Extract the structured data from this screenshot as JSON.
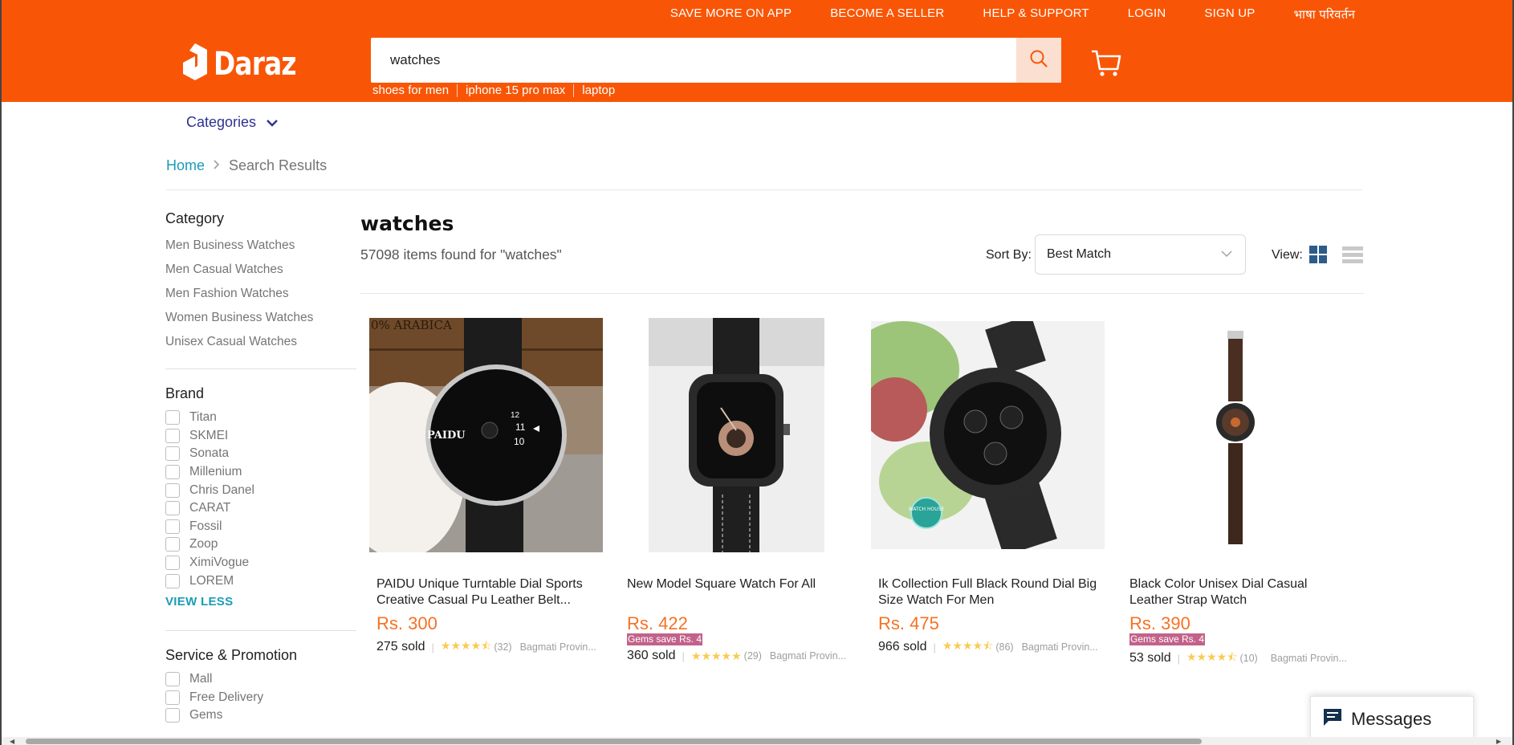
{
  "header": {
    "top_links": [
      "SAVE MORE ON APP",
      "BECOME A SELLER",
      "HELP & SUPPORT",
      "LOGIN",
      "SIGN UP",
      "भाषा परिवर्तन"
    ],
    "logo_text": "Daraz",
    "search": {
      "value": "watches"
    },
    "suggestions": [
      "shoes for men",
      "iphone 15 pro max",
      "laptop"
    ],
    "brand_color": "#f85606"
  },
  "nav": {
    "categories_label": "Categories"
  },
  "breadcrumb": {
    "home": "Home",
    "current": "Search Results"
  },
  "sidebar": {
    "category_title": "Category",
    "categories": [
      "Men Business Watches",
      "Men Casual Watches",
      "Men Fashion Watches",
      "Women Business Watches",
      "Unisex Casual Watches"
    ],
    "brand_title": "Brand",
    "brands": [
      "Titan",
      "SKMEI",
      "Sonata",
      "Millenium",
      "Chris Danel",
      "CARAT",
      "Fossil",
      "Zoop",
      "XimiVogue",
      "LOREM"
    ],
    "view_less": "VIEW LESS",
    "service_title": "Service & Promotion",
    "services": [
      "Mall",
      "Free Delivery",
      "Gems"
    ]
  },
  "results": {
    "title": "watches",
    "count_text": "57098 items found for \"watches\"",
    "sort_label": "Sort By:",
    "sort_value": "Best Match",
    "view_label": "View:"
  },
  "products": [
    {
      "name": "PAIDU Unique Turntable Dial Sports Creative Casual Pu Leather Belt...",
      "price": "Rs. 300",
      "gems": "",
      "sold": "275 sold",
      "rating": 4.5,
      "reviews": "(32)",
      "location": "Bagmati Provin..."
    },
    {
      "name": "New Model Square Watch For All",
      "price": "Rs. 422",
      "gems": "Gems save Rs. 4",
      "sold": "360 sold",
      "rating": 5,
      "reviews": "(29)",
      "location": "Bagmati Provin..."
    },
    {
      "name": "Ik Collection Full Black Round Dial Big Size Watch For Men",
      "price": "Rs. 475",
      "gems": "",
      "sold": "966 sold",
      "rating": 4.5,
      "reviews": "(86)",
      "location": "Bagmati Provin..."
    },
    {
      "name": "Black Color Unisex Dial Casual Leather Strap Watch",
      "price": "Rs. 390",
      "gems": "Gems save Rs. 4",
      "sold": "53 sold",
      "rating": 4.5,
      "reviews": "(10)",
      "location": "Bagmati Provin..."
    }
  ],
  "product_image_texts": [
    "0% ARABICA",
    "PAIDU",
    "WATCH HOUSE"
  ],
  "messages_label": "Messages",
  "icons": [
    "logo-icon",
    "search-icon",
    "cart-icon",
    "chevron-down-icon",
    "chevron-right-icon",
    "grid-view-icon",
    "list-view-icon",
    "chat-icon"
  ]
}
